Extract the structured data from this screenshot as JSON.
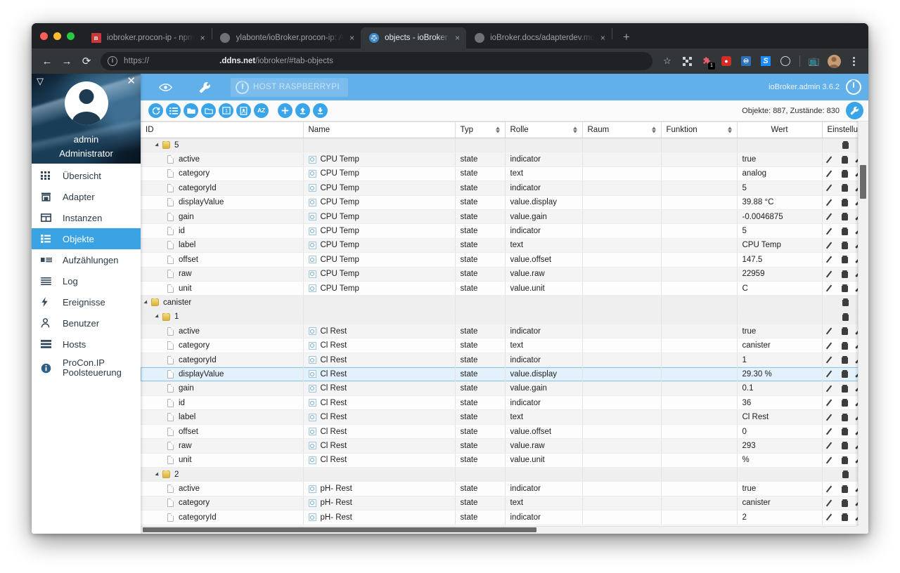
{
  "browser": {
    "tabs": [
      {
        "title": "iobroker.procon-ip - npm",
        "favicon": "npm-icon",
        "active": false
      },
      {
        "title": "ylabonte/ioBroker.procon-ip: A",
        "favicon": "github-icon",
        "active": false
      },
      {
        "title": "objects - ioBroker",
        "favicon": "iobroker-icon",
        "active": true
      },
      {
        "title": "ioBroker.docs/adapterdev.md",
        "favicon": "github-icon",
        "active": false
      }
    ],
    "new_tab_label": "+",
    "close_label": "×",
    "nav": {
      "back": "←",
      "forward": "→",
      "reload": "⟳"
    },
    "omnibox": {
      "info_icon": "info-icon",
      "scheme": "https://",
      "host": ".ddns.net",
      "path": "/iobroker/#tab-objects"
    },
    "extensions": [
      {
        "name": "qr-code-icon",
        "badge": ""
      },
      {
        "name": "extension-puzzle-icon",
        "badge": "1"
      },
      {
        "name": "lastpass-icon",
        "badge": ""
      },
      {
        "name": "bitwarden-icon",
        "badge": ""
      },
      {
        "name": "stylus-icon",
        "badge": ""
      },
      {
        "name": "clock-icon",
        "badge": ""
      }
    ],
    "cast_icon": "cast-icon",
    "profile_icon": "profile-avatar",
    "menu_icon": "kebab-menu-icon"
  },
  "sidebar": {
    "collapse_icon": "collapse-triangle-icon",
    "close_icon": "close-icon",
    "avatar_icon": "user-avatar-icon",
    "user_name": "admin",
    "user_role": "Administrator",
    "items": [
      {
        "label": "Übersicht",
        "icon": "grid-icon",
        "active": false
      },
      {
        "label": "Adapter",
        "icon": "store-icon",
        "active": false
      },
      {
        "label": "Instanzen",
        "icon": "instances-icon",
        "active": false
      },
      {
        "label": "Objekte",
        "icon": "objects-list-icon",
        "active": true
      },
      {
        "label": "Aufzählungen",
        "icon": "enum-icon",
        "active": false
      },
      {
        "label": "Log",
        "icon": "log-lines-icon",
        "active": false
      },
      {
        "label": "Ereignisse",
        "icon": "lightning-icon",
        "active": false
      },
      {
        "label": "Benutzer",
        "icon": "user-icon",
        "active": false
      },
      {
        "label": "Hosts",
        "icon": "hosts-icon",
        "active": false
      },
      {
        "label": "ProCon.IP\nPoolsteuerung",
        "icon": "info-circle-icon",
        "active": false
      }
    ]
  },
  "app_header": {
    "eye_icon": "eye-icon",
    "wrench_icon": "wrench-icon",
    "host_label": "HOST RASPBERRYPI",
    "host_power_icon": "power-icon",
    "version": "ioBroker.admin 3.6.2",
    "power_icon": "power-icon"
  },
  "table_toolbar": {
    "buttons": [
      {
        "name": "refresh-button",
        "icon": "⟳"
      },
      {
        "name": "expand-all-button",
        "icon": "☰"
      },
      {
        "name": "collapse-folder-button",
        "icon": "▰"
      },
      {
        "name": "folder-button",
        "icon": "▭"
      },
      {
        "name": "level-one-button",
        "icon": "1"
      },
      {
        "name": "id-card-button",
        "icon": "▣"
      },
      {
        "name": "sort-az-button",
        "icon": "AZ"
      },
      {
        "name": "add-object-button",
        "icon": "+"
      },
      {
        "name": "upload-button",
        "icon": "⬆"
      },
      {
        "name": "download-button",
        "icon": "⬇"
      }
    ],
    "stats": "Objekte: 887, Zustände: 830",
    "settings_icon": "wrench-icon"
  },
  "table": {
    "columns": [
      {
        "label": "ID",
        "sortable": false,
        "align": "left"
      },
      {
        "label": "Name",
        "sortable": false,
        "align": "left"
      },
      {
        "label": "Typ",
        "sortable": true,
        "align": "left"
      },
      {
        "label": "Rolle",
        "sortable": true,
        "align": "left"
      },
      {
        "label": "Raum",
        "sortable": true,
        "align": "left"
      },
      {
        "label": "Funktion",
        "sortable": true,
        "align": "left"
      },
      {
        "label": "Wert",
        "sortable": false,
        "align": "center"
      },
      {
        "label": "Einstellun",
        "sortable": true,
        "align": "left"
      }
    ],
    "rows": [
      {
        "kind": "folder",
        "indent": 1,
        "id": "5",
        "name": "",
        "typ": "",
        "rolle": "",
        "raum": "",
        "funktion": "",
        "wert": "",
        "actions": [
          "delete"
        ]
      },
      {
        "kind": "state",
        "indent": 2,
        "id": "active",
        "name": "CPU Temp",
        "typ": "state",
        "rolle": "indicator",
        "raum": "",
        "funktion": "",
        "wert": "true",
        "actions": [
          "edit",
          "delete",
          "settings"
        ]
      },
      {
        "kind": "state",
        "indent": 2,
        "id": "category",
        "name": "CPU Temp",
        "typ": "state",
        "rolle": "text",
        "raum": "",
        "funktion": "",
        "wert": "analog",
        "actions": [
          "edit",
          "delete",
          "settings"
        ]
      },
      {
        "kind": "state",
        "indent": 2,
        "id": "categoryId",
        "name": "CPU Temp",
        "typ": "state",
        "rolle": "indicator",
        "raum": "",
        "funktion": "",
        "wert": "5",
        "actions": [
          "edit",
          "delete",
          "settings"
        ]
      },
      {
        "kind": "state",
        "indent": 2,
        "id": "displayValue",
        "name": "CPU Temp",
        "typ": "state",
        "rolle": "value.display",
        "raum": "",
        "funktion": "",
        "wert": "39.88 °C",
        "actions": [
          "edit",
          "delete",
          "settings"
        ]
      },
      {
        "kind": "state",
        "indent": 2,
        "id": "gain",
        "name": "CPU Temp",
        "typ": "state",
        "rolle": "value.gain",
        "raum": "",
        "funktion": "",
        "wert": "-0.0046875",
        "actions": [
          "edit",
          "delete",
          "settings"
        ]
      },
      {
        "kind": "state",
        "indent": 2,
        "id": "id",
        "name": "CPU Temp",
        "typ": "state",
        "rolle": "indicator",
        "raum": "",
        "funktion": "",
        "wert": "5",
        "actions": [
          "edit",
          "delete",
          "settings"
        ]
      },
      {
        "kind": "state",
        "indent": 2,
        "id": "label",
        "name": "CPU Temp",
        "typ": "state",
        "rolle": "text",
        "raum": "",
        "funktion": "",
        "wert": "CPU Temp",
        "actions": [
          "edit",
          "delete",
          "settings"
        ]
      },
      {
        "kind": "state",
        "indent": 2,
        "id": "offset",
        "name": "CPU Temp",
        "typ": "state",
        "rolle": "value.offset",
        "raum": "",
        "funktion": "",
        "wert": "147.5",
        "actions": [
          "edit",
          "delete",
          "settings"
        ]
      },
      {
        "kind": "state",
        "indent": 2,
        "id": "raw",
        "name": "CPU Temp",
        "typ": "state",
        "rolle": "value.raw",
        "raum": "",
        "funktion": "",
        "wert": "22959",
        "actions": [
          "edit",
          "delete",
          "settings"
        ]
      },
      {
        "kind": "state",
        "indent": 2,
        "id": "unit",
        "name": "CPU Temp",
        "typ": "state",
        "rolle": "value.unit",
        "raum": "",
        "funktion": "",
        "wert": "C",
        "actions": [
          "edit",
          "delete",
          "settings"
        ]
      },
      {
        "kind": "folder",
        "indent": 0,
        "id": "canister",
        "name": "",
        "typ": "",
        "rolle": "",
        "raum": "",
        "funktion": "",
        "wert": "",
        "actions": [
          "delete"
        ]
      },
      {
        "kind": "folder",
        "indent": 1,
        "id": "1",
        "name": "",
        "typ": "",
        "rolle": "",
        "raum": "",
        "funktion": "",
        "wert": "",
        "actions": [
          "delete"
        ]
      },
      {
        "kind": "state",
        "indent": 2,
        "id": "active",
        "name": "Cl Rest",
        "typ": "state",
        "rolle": "indicator",
        "raum": "",
        "funktion": "",
        "wert": "true",
        "actions": [
          "edit",
          "delete",
          "settings"
        ]
      },
      {
        "kind": "state",
        "indent": 2,
        "id": "category",
        "name": "Cl Rest",
        "typ": "state",
        "rolle": "text",
        "raum": "",
        "funktion": "",
        "wert": "canister",
        "actions": [
          "edit",
          "delete",
          "settings"
        ]
      },
      {
        "kind": "state",
        "indent": 2,
        "id": "categoryId",
        "name": "Cl Rest",
        "typ": "state",
        "rolle": "indicator",
        "raum": "",
        "funktion": "",
        "wert": "1",
        "actions": [
          "edit",
          "delete",
          "settings"
        ]
      },
      {
        "kind": "state",
        "indent": 2,
        "id": "displayValue",
        "name": "Cl Rest",
        "typ": "state",
        "rolle": "value.display",
        "raum": "",
        "funktion": "",
        "wert": "29.30 %",
        "selected": true,
        "actions": [
          "edit",
          "delete",
          "settings"
        ]
      },
      {
        "kind": "state",
        "indent": 2,
        "id": "gain",
        "name": "Cl Rest",
        "typ": "state",
        "rolle": "value.gain",
        "raum": "",
        "funktion": "",
        "wert": "0.1",
        "actions": [
          "edit",
          "delete",
          "settings"
        ]
      },
      {
        "kind": "state",
        "indent": 2,
        "id": "id",
        "name": "Cl Rest",
        "typ": "state",
        "rolle": "indicator",
        "raum": "",
        "funktion": "",
        "wert": "36",
        "actions": [
          "edit",
          "delete",
          "settings"
        ]
      },
      {
        "kind": "state",
        "indent": 2,
        "id": "label",
        "name": "Cl Rest",
        "typ": "state",
        "rolle": "text",
        "raum": "",
        "funktion": "",
        "wert": "Cl Rest",
        "actions": [
          "edit",
          "delete",
          "settings"
        ]
      },
      {
        "kind": "state",
        "indent": 2,
        "id": "offset",
        "name": "Cl Rest",
        "typ": "state",
        "rolle": "value.offset",
        "raum": "",
        "funktion": "",
        "wert": "0",
        "actions": [
          "edit",
          "delete",
          "settings"
        ]
      },
      {
        "kind": "state",
        "indent": 2,
        "id": "raw",
        "name": "Cl Rest",
        "typ": "state",
        "rolle": "value.raw",
        "raum": "",
        "funktion": "",
        "wert": "293",
        "actions": [
          "edit",
          "delete",
          "settings"
        ]
      },
      {
        "kind": "state",
        "indent": 2,
        "id": "unit",
        "name": "Cl Rest",
        "typ": "state",
        "rolle": "value.unit",
        "raum": "",
        "funktion": "",
        "wert": "%",
        "actions": [
          "edit",
          "delete",
          "settings"
        ]
      },
      {
        "kind": "folder",
        "indent": 1,
        "id": "2",
        "name": "",
        "typ": "",
        "rolle": "",
        "raum": "",
        "funktion": "",
        "wert": "",
        "actions": [
          "delete"
        ]
      },
      {
        "kind": "state",
        "indent": 2,
        "id": "active",
        "name": "pH- Rest",
        "typ": "state",
        "rolle": "indicator",
        "raum": "",
        "funktion": "",
        "wert": "true",
        "actions": [
          "edit",
          "delete",
          "settings"
        ]
      },
      {
        "kind": "state",
        "indent": 2,
        "id": "category",
        "name": "pH- Rest",
        "typ": "state",
        "rolle": "text",
        "raum": "",
        "funktion": "",
        "wert": "canister",
        "actions": [
          "edit",
          "delete",
          "settings"
        ]
      },
      {
        "kind": "state",
        "indent": 2,
        "id": "categoryId",
        "name": "pH- Rest",
        "typ": "state",
        "rolle": "indicator",
        "raum": "",
        "funktion": "",
        "wert": "2",
        "actions": [
          "edit",
          "delete",
          "settings"
        ]
      }
    ]
  }
}
